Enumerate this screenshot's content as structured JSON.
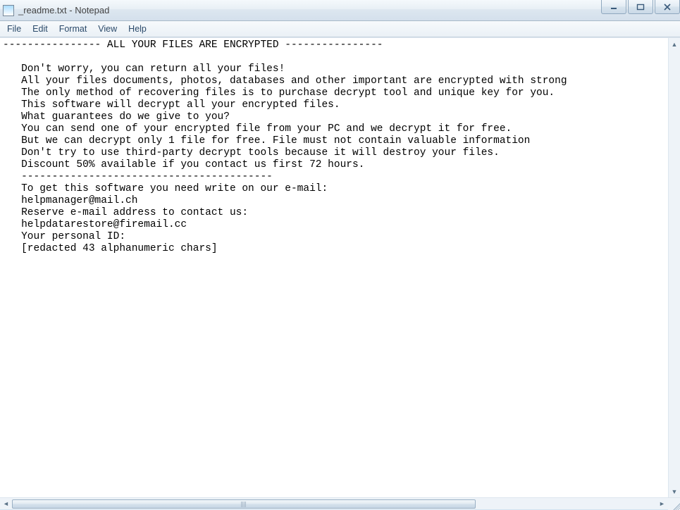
{
  "window": {
    "title": "_readme.txt - Notepad"
  },
  "menu": {
    "file": "File",
    "edit": "Edit",
    "format": "Format",
    "view": "View",
    "help": "Help"
  },
  "content": {
    "lines": [
      "---------------- ALL YOUR FILES ARE ENCRYPTED ----------------",
      "",
      "   Don't worry, you can return all your files!",
      "   All your files documents, photos, databases and other important are encrypted with strong",
      "   The only method of recovering files is to purchase decrypt tool and unique key for you.",
      "   This software will decrypt all your encrypted files.",
      "   What guarantees do we give to you?",
      "   You can send one of your encrypted file from your PC and we decrypt it for free.",
      "   But we can decrypt only 1 file for free. File must not contain valuable information",
      "   Don't try to use third-party decrypt tools because it will destroy your files.",
      "   Discount 50% available if you contact us first 72 hours.",
      "   -----------------------------------------",
      "   To get this software you need write on our e-mail:",
      "   helpmanager@mail.ch",
      "   Reserve e-mail address to contact us:",
      "   helpdatarestore@firemail.cc",
      "   Your personal ID:",
      "   [redacted 43 alphanumeric chars]"
    ]
  }
}
